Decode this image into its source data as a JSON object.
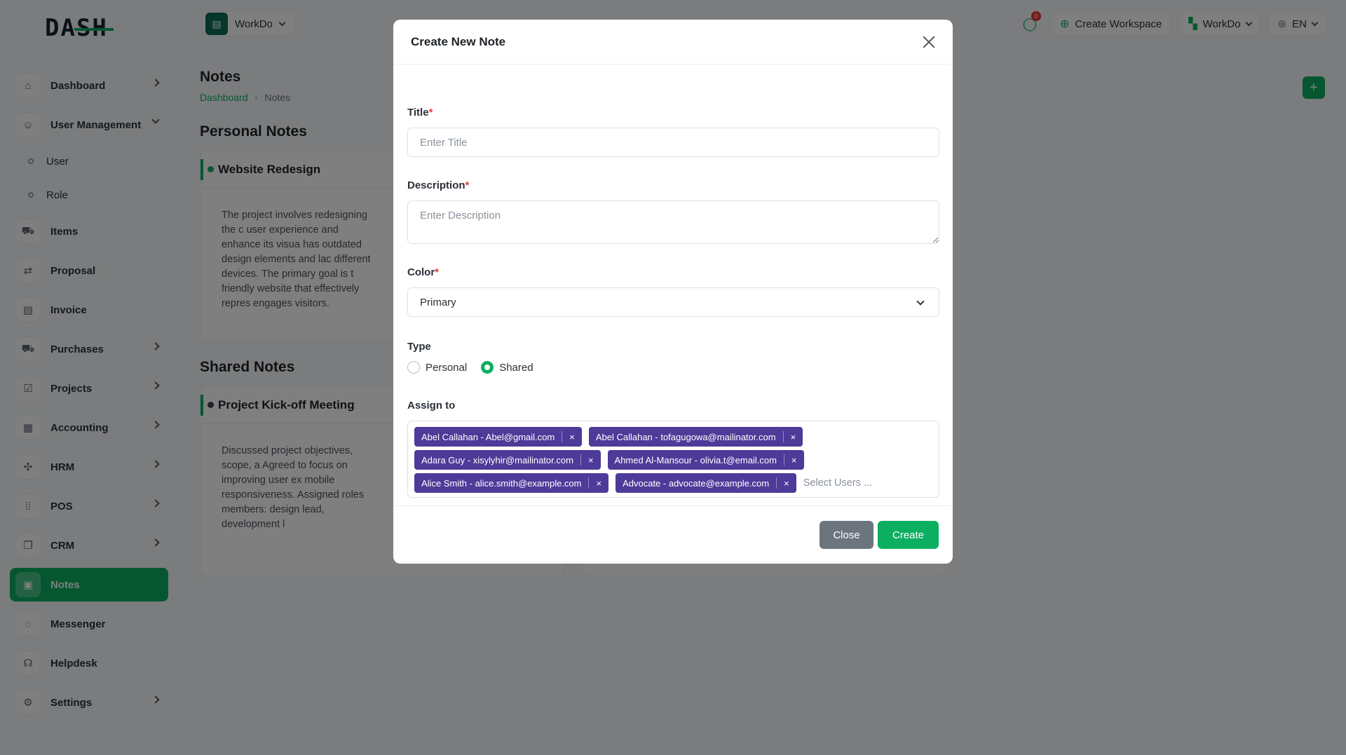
{
  "brand": {
    "logo_text": "DASH"
  },
  "header": {
    "workspace_name": "WorkDo",
    "message_count": "0",
    "create_workspace": "Create Workspace",
    "workspace_selector": "WorkDo",
    "language": "EN"
  },
  "sidebar": {
    "items": [
      {
        "label": "Dashboard"
      },
      {
        "label": "User Management"
      },
      {
        "label": "Items"
      },
      {
        "label": "Proposal"
      },
      {
        "label": "Invoice"
      },
      {
        "label": "Purchases"
      },
      {
        "label": "Projects"
      },
      {
        "label": "Accounting"
      },
      {
        "label": "HRM"
      },
      {
        "label": "POS"
      },
      {
        "label": "CRM"
      },
      {
        "label": "Notes"
      },
      {
        "label": "Messenger"
      },
      {
        "label": "Helpdesk"
      },
      {
        "label": "Settings"
      }
    ],
    "sub_items": [
      {
        "label": "User"
      },
      {
        "label": "Role"
      }
    ]
  },
  "page": {
    "title": "Notes",
    "breadcrumb": [
      "Dashboard",
      "Notes"
    ],
    "personal_section": "Personal Notes",
    "shared_section": "Shared Notes",
    "personal_note": {
      "title": "Website Redesign",
      "body": "The project involves redesigning the c user experience and enhance its visua has outdated design elements and lac different devices. The primary goal is t friendly website that effectively repres engages visitors."
    },
    "shared_note": {
      "title": "Project Kick-off Meeting",
      "body": "Discussed project objectives, scope, a Agreed to focus on improving user ex mobile responsiveness. Assigned roles members: design lead, development l"
    }
  },
  "modal": {
    "title": "Create New Note",
    "title_label": "Title",
    "title_placeholder": "Enter Title",
    "description_label": "Description",
    "description_placeholder": "Enter Description",
    "color_label": "Color",
    "color_value": "Primary",
    "type_label": "Type",
    "type_options": [
      "Personal",
      "Shared"
    ],
    "type_selected": "Shared",
    "assign_label": "Assign to",
    "assignees": [
      "Abel Callahan - Abel@gmail.com",
      "Abel Callahan - tofagugowa@mailinator.com",
      "Adara Guy - xisylyhir@mailinator.com",
      "Ahmed Al-Mansour - olivia.t@email.com",
      "Alice Smith - alice.smith@example.com",
      "Advocate - advocate@example.com"
    ],
    "assign_placeholder": "Select Users ...",
    "close_button": "Close",
    "create_button": "Create",
    "required_mark": "*",
    "remove_mark": "×"
  },
  "colors": {
    "accent": "#0caf60",
    "tag": "#4e3a99",
    "danger": "#e53935",
    "secondary": "#6c757d"
  }
}
